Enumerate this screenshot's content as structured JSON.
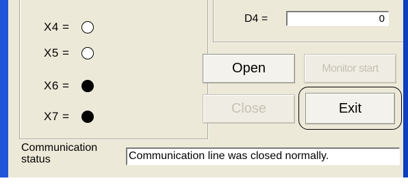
{
  "inputs": [
    {
      "label": "X4 =",
      "state": "off"
    },
    {
      "label": "X5 =",
      "state": "off"
    },
    {
      "label": "X6 =",
      "state": "on"
    },
    {
      "label": "X7 =",
      "state": "on"
    }
  ],
  "register": {
    "label": "D4 =",
    "value": "0"
  },
  "buttons": {
    "open": "Open",
    "monitor_start": "Monitor start",
    "close": "Close",
    "exit": "Exit"
  },
  "communication": {
    "label_line1": "Communication",
    "label_line2": "status",
    "status_text": "Communication line was closed normally."
  },
  "colors": {
    "window_frame": "#1f55d8",
    "dialog_background": "#ece9d8",
    "lamp_on": "#000000",
    "lamp_off": "#ffffff"
  }
}
